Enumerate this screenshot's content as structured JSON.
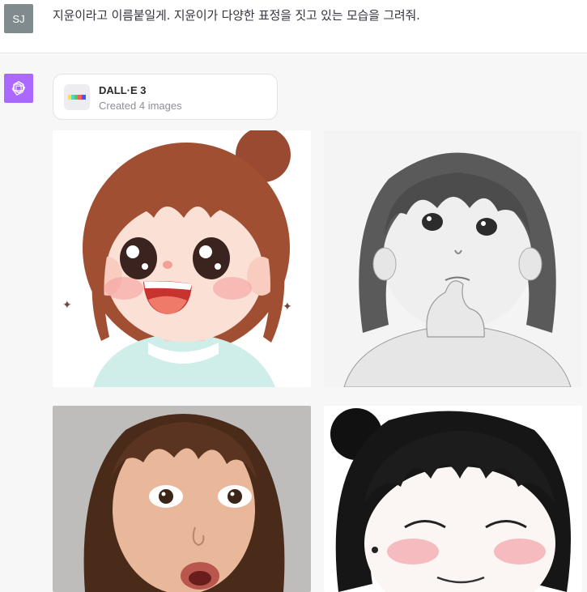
{
  "user": {
    "avatar_initials": "SJ",
    "message": "지윤이라고 이름붙일게. 지윤이가 다양한 표정을 짓고 있는 모습을 그려줘."
  },
  "assistant": {
    "avatar_icon": "openai-logo-icon",
    "tool": {
      "name": "DALL·E 3",
      "status": "Created 4 images",
      "icon": "dalle-palette-icon"
    },
    "images": [
      {
        "name": "image-1",
        "subject": "cartoon girl laughing"
      },
      {
        "name": "image-2",
        "subject": "pencil sketch girl thinking"
      },
      {
        "name": "image-3",
        "subject": "realistic woman surprised"
      },
      {
        "name": "image-4",
        "subject": "ink sketch girl smiling eyes closed"
      }
    ]
  },
  "colors": {
    "user_avatar_bg": "#7f8b8c",
    "assistant_avatar_bg": "#ab68ff",
    "assistant_row_bg": "#f7f7f8"
  }
}
